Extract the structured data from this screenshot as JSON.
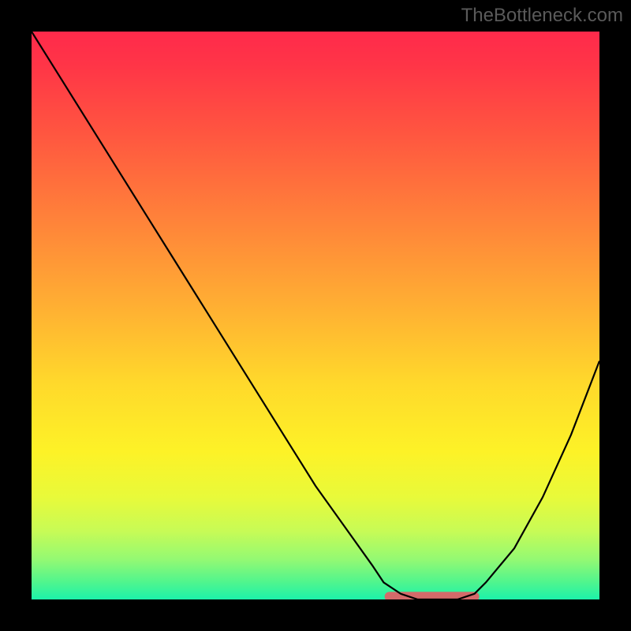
{
  "watermark": "TheBottleneck.com",
  "chart_data": {
    "type": "line",
    "title": "",
    "xlabel": "",
    "ylabel": "",
    "xlim": [
      0,
      100
    ],
    "ylim": [
      0,
      100
    ],
    "series": [
      {
        "name": "bottleneck-curve",
        "x": [
          0,
          5,
          10,
          15,
          20,
          25,
          30,
          35,
          40,
          45,
          50,
          55,
          60,
          62,
          65,
          68,
          70,
          72,
          75,
          78,
          80,
          85,
          90,
          95,
          100
        ],
        "y": [
          100,
          92,
          84,
          76,
          68,
          60,
          52,
          44,
          36,
          28,
          20,
          13,
          6,
          3,
          1,
          0,
          0,
          0,
          0,
          1,
          3,
          9,
          18,
          29,
          42
        ]
      }
    ],
    "highlight": {
      "name": "optimal-flat-region",
      "x_start": 63,
      "x_end": 78,
      "y": 0.5,
      "color": "#d46a6a"
    },
    "background_gradient": {
      "top": "#ff2a4b",
      "bottom": "#1cf2aa",
      "stops": [
        "red",
        "orange",
        "yellow",
        "green"
      ]
    }
  }
}
